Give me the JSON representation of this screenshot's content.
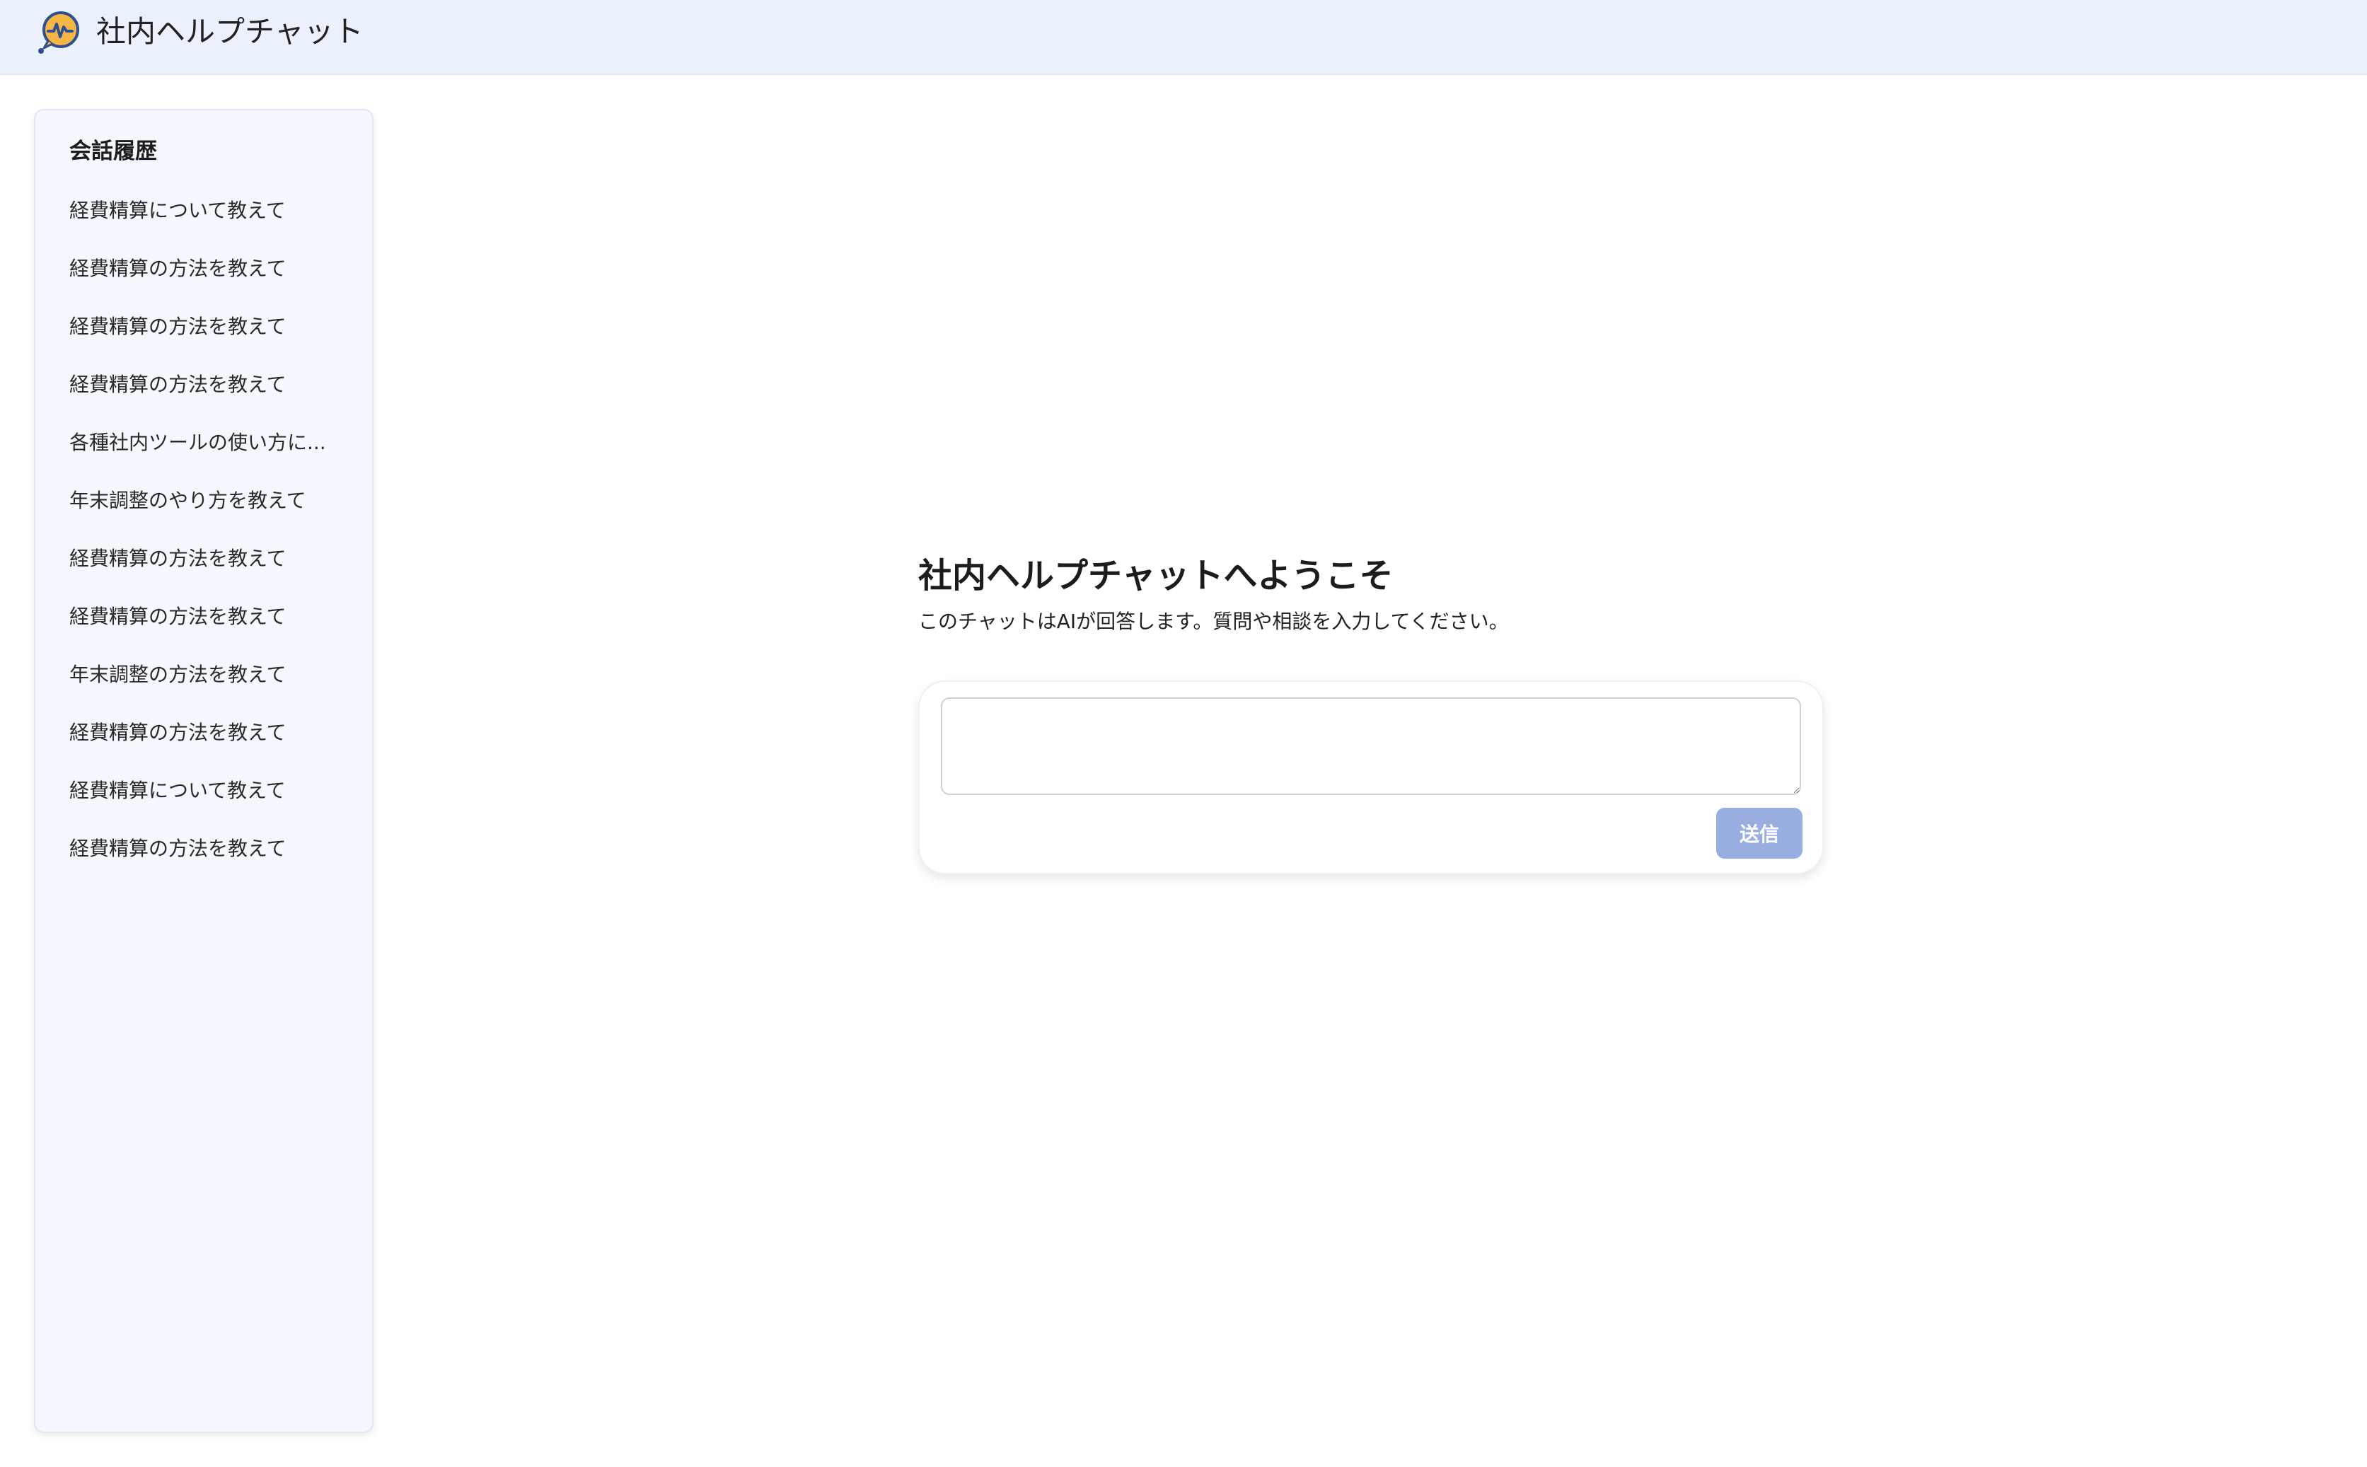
{
  "header": {
    "app_title": "社内ヘルプチャット",
    "logo_icon": "chat-bubble-heartbeat-icon",
    "colors": {
      "header_bg": "#eaf1fd",
      "logo_orange": "#f5b547",
      "logo_navy": "#2f4f8f"
    }
  },
  "sidebar": {
    "heading": "会話履歴",
    "items": [
      {
        "label": "経費精算について教えて"
      },
      {
        "label": "経費精算の方法を教えて"
      },
      {
        "label": "経費精算の方法を教えて"
      },
      {
        "label": "経費精算の方法を教えて"
      },
      {
        "label": "各種社内ツールの使い方に..."
      },
      {
        "label": "年末調整のやり方を教えて"
      },
      {
        "label": "経費精算の方法を教えて"
      },
      {
        "label": "経費精算の方法を教えて"
      },
      {
        "label": "年末調整の方法を教えて"
      },
      {
        "label": "経費精算の方法を教えて"
      },
      {
        "label": "経費精算について教えて"
      },
      {
        "label": "経費精算の方法を教えて"
      }
    ]
  },
  "main": {
    "welcome_title": "社内ヘルプチャットへようこそ",
    "welcome_subtitle": "このチャットはAIが回答します。質問や相談を入力してください。",
    "input": {
      "value": "",
      "placeholder": ""
    },
    "send_label": "送信",
    "colors": {
      "send_button_disabled": "#98aee0"
    }
  }
}
